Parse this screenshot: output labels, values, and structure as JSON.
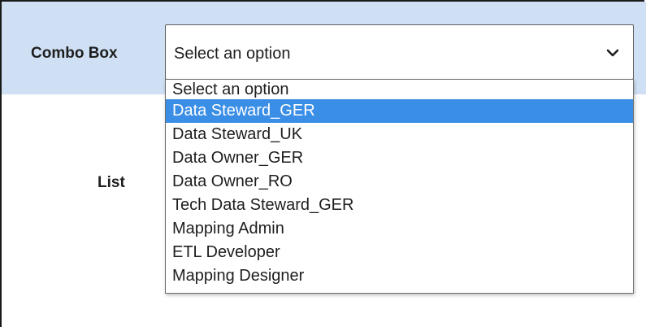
{
  "combo": {
    "label": "Combo Box",
    "value": "Select an option",
    "dropdown_icon": "chevron-down-icon"
  },
  "list": {
    "label": "List"
  },
  "dropdown": {
    "highlighted_index": 1,
    "highlight_color": "#3a8ee6",
    "options": [
      "Select an option",
      "Data Steward_GER",
      "Data Steward_UK",
      "Data Owner_GER",
      "Data Owner_RO",
      "Tech Data Steward_GER",
      "Mapping Admin",
      "ETL Developer",
      "Mapping Designer"
    ]
  }
}
